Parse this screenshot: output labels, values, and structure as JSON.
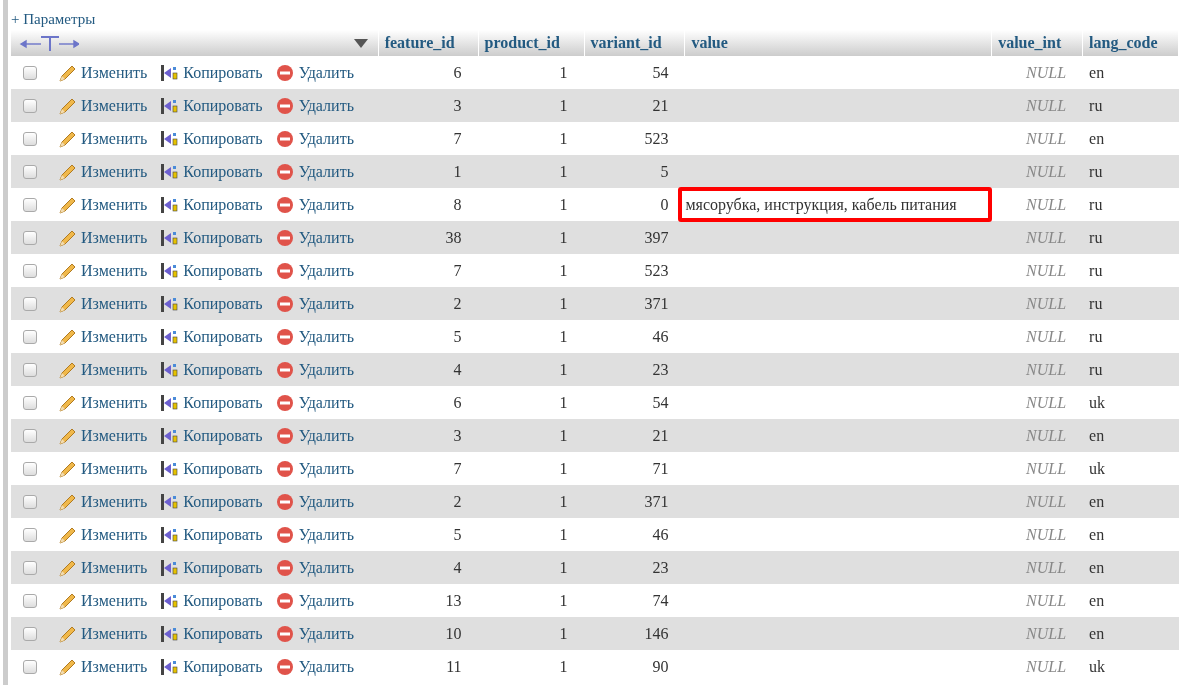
{
  "options_link": "+ Параметры",
  "table": {
    "columns": [
      "feature_id",
      "product_id",
      "variant_id",
      "value",
      "value_int",
      "lang_code"
    ],
    "rows": [
      {
        "checked": false,
        "actions": [
          "Изменить",
          "Копировать",
          "Удалить"
        ],
        "cells": [
          "6",
          "1",
          "54",
          "",
          "NULL",
          "en"
        ]
      },
      {
        "checked": false,
        "actions": [
          "Изменить",
          "Копировать",
          "Удалить"
        ],
        "cells": [
          "3",
          "1",
          "21",
          "",
          "NULL",
          "ru"
        ]
      },
      {
        "checked": false,
        "actions": [
          "Изменить",
          "Копировать",
          "Удалить"
        ],
        "cells": [
          "7",
          "1",
          "523",
          "",
          "NULL",
          "en"
        ]
      },
      {
        "checked": false,
        "actions": [
          "Изменить",
          "Копировать",
          "Удалить"
        ],
        "cells": [
          "1",
          "1",
          "5",
          "",
          "NULL",
          "ru"
        ]
      },
      {
        "checked": false,
        "actions": [
          "Изменить",
          "Копировать",
          "Удалить"
        ],
        "cells": [
          "8",
          "1",
          "0",
          "мясорубка, инструкция, кабель питания",
          "NULL",
          "ru"
        ],
        "highlighted": true
      },
      {
        "checked": false,
        "actions": [
          "Изменить",
          "Копировать",
          "Удалить"
        ],
        "cells": [
          "38",
          "1",
          "397",
          "",
          "NULL",
          "ru"
        ]
      },
      {
        "checked": false,
        "actions": [
          "Изменить",
          "Копировать",
          "Удалить"
        ],
        "cells": [
          "7",
          "1",
          "523",
          "",
          "NULL",
          "ru"
        ]
      },
      {
        "checked": false,
        "actions": [
          "Изменить",
          "Копировать",
          "Удалить"
        ],
        "cells": [
          "2",
          "1",
          "371",
          "",
          "NULL",
          "ru"
        ]
      },
      {
        "checked": false,
        "actions": [
          "Изменить",
          "Копировать",
          "Удалить"
        ],
        "cells": [
          "5",
          "1",
          "46",
          "",
          "NULL",
          "ru"
        ]
      },
      {
        "checked": false,
        "actions": [
          "Изменить",
          "Копировать",
          "Удалить"
        ],
        "cells": [
          "4",
          "1",
          "23",
          "",
          "NULL",
          "ru"
        ]
      },
      {
        "checked": false,
        "actions": [
          "Изменить",
          "Копировать",
          "Удалить"
        ],
        "cells": [
          "6",
          "1",
          "54",
          "",
          "NULL",
          "uk"
        ]
      },
      {
        "checked": false,
        "actions": [
          "Изменить",
          "Копировать",
          "Удалить"
        ],
        "cells": [
          "3",
          "1",
          "21",
          "",
          "NULL",
          "en"
        ]
      },
      {
        "checked": false,
        "actions": [
          "Изменить",
          "Копировать",
          "Удалить"
        ],
        "cells": [
          "7",
          "1",
          "71",
          "",
          "NULL",
          "uk"
        ]
      },
      {
        "checked": false,
        "actions": [
          "Изменить",
          "Копировать",
          "Удалить"
        ],
        "cells": [
          "2",
          "1",
          "371",
          "",
          "NULL",
          "en"
        ]
      },
      {
        "checked": false,
        "actions": [
          "Изменить",
          "Копировать",
          "Удалить"
        ],
        "cells": [
          "5",
          "1",
          "46",
          "",
          "NULL",
          "en"
        ]
      },
      {
        "checked": false,
        "actions": [
          "Изменить",
          "Копировать",
          "Удалить"
        ],
        "cells": [
          "4",
          "1",
          "23",
          "",
          "NULL",
          "en"
        ]
      },
      {
        "checked": false,
        "actions": [
          "Изменить",
          "Копировать",
          "Удалить"
        ],
        "cells": [
          "13",
          "1",
          "74",
          "",
          "NULL",
          "en"
        ]
      },
      {
        "checked": false,
        "actions": [
          "Изменить",
          "Копировать",
          "Удалить"
        ],
        "cells": [
          "10",
          "1",
          "146",
          "",
          "NULL",
          "en"
        ]
      },
      {
        "checked": false,
        "actions": [
          "Изменить",
          "Копировать",
          "Удалить"
        ],
        "cells": [
          "11",
          "1",
          "90",
          "",
          "NULL",
          "uk"
        ]
      }
    ]
  }
}
